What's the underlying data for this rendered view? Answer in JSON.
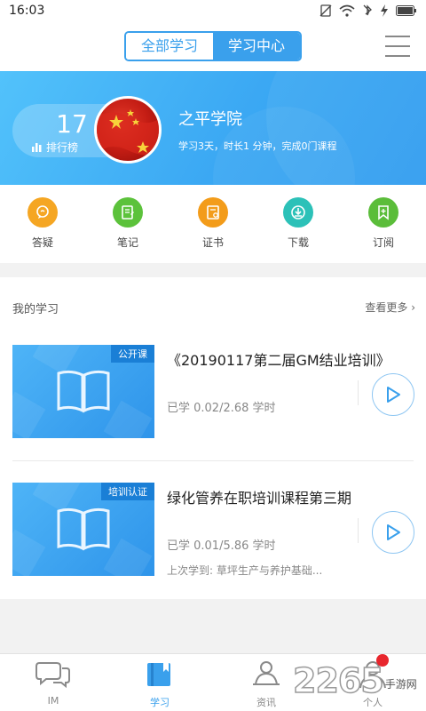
{
  "status_bar": {
    "time": "16:03"
  },
  "header": {
    "segments": [
      "全部学习",
      "学习中心"
    ],
    "active_segment": "学习中心"
  },
  "profile": {
    "rank_number": "17",
    "rank_label": "排行榜",
    "org_name": "之平学院",
    "stats": "学习3天，时长1 分钟，完成0门课程"
  },
  "quick_actions": [
    {
      "label": "答疑",
      "color": "#f5a623",
      "icon": "chat-bubble-icon"
    },
    {
      "label": "笔记",
      "color": "#5cc23b",
      "icon": "notebook-icon"
    },
    {
      "label": "证书",
      "color": "#f39c1a",
      "icon": "certificate-icon"
    },
    {
      "label": "下载",
      "color": "#2cc1b8",
      "icon": "download-icon"
    },
    {
      "label": "订阅",
      "color": "#5bbd3a",
      "icon": "subscribe-icon"
    }
  ],
  "my_study": {
    "title": "我的学习",
    "more": "查看更多 ›",
    "courses": [
      {
        "tag": "公开课",
        "title": "《20190117第二届GM结业培训》",
        "progress": "已学 0.02/2.68 学时",
        "last": ""
      },
      {
        "tag": "培训认证",
        "title": "绿化管养在职培训课程第三期",
        "progress": "已学 0.01/5.86 学时",
        "last": "上次学到: 草坪生产与养护基础..."
      }
    ]
  },
  "tabbar": {
    "tabs": [
      {
        "label": "IM",
        "icon": "chat-icon"
      },
      {
        "label": "学习",
        "icon": "book-icon"
      },
      {
        "label": "资讯",
        "icon": "news-icon"
      },
      {
        "label": "个人",
        "icon": "person-icon"
      }
    ],
    "active": "学习"
  },
  "watermark": {
    "number": "2265",
    "text": "手游网"
  },
  "colors": {
    "accent": "#3aa0ec",
    "badge": "#e8262d"
  }
}
